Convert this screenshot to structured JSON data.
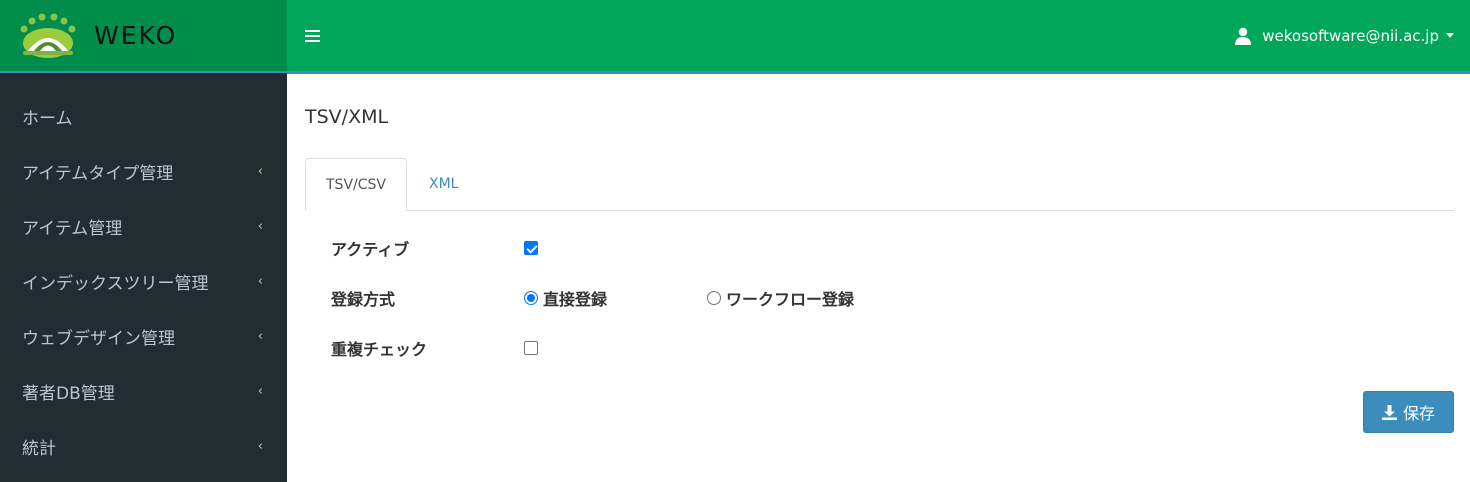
{
  "logo": {
    "text": "WEKO"
  },
  "sidebar": {
    "items": [
      {
        "label": "ホーム",
        "has_submenu": false
      },
      {
        "label": "アイテムタイプ管理",
        "has_submenu": true
      },
      {
        "label": "アイテム管理",
        "has_submenu": true
      },
      {
        "label": "インデックスツリー管理",
        "has_submenu": true
      },
      {
        "label": "ウェブデザイン管理",
        "has_submenu": true
      },
      {
        "label": "著者DB管理",
        "has_submenu": true
      },
      {
        "label": "統計",
        "has_submenu": true
      }
    ],
    "chevron": "‹"
  },
  "header": {
    "user_email": "wekosoftware@nii.ac.jp"
  },
  "page": {
    "title": "TSV/XML"
  },
  "tabs": [
    {
      "label": "TSV/CSV",
      "active": true
    },
    {
      "label": "XML",
      "active": false
    }
  ],
  "form": {
    "active": {
      "label": "アクティブ",
      "checked": true
    },
    "registration": {
      "label": "登録方式",
      "options": [
        {
          "label": "直接登録",
          "selected": true
        },
        {
          "label": "ワークフロー登録",
          "selected": false
        }
      ]
    },
    "duplicate_check": {
      "label": "重複チェック",
      "checked": false
    }
  },
  "buttons": {
    "save_label": "保存"
  },
  "colors": {
    "header_green": "#00a65a",
    "logo_green": "#008d4c",
    "sidebar_dark": "#222d32",
    "accent_blue": "#3c8dbc",
    "checkbox_blue": "#0075ff"
  }
}
